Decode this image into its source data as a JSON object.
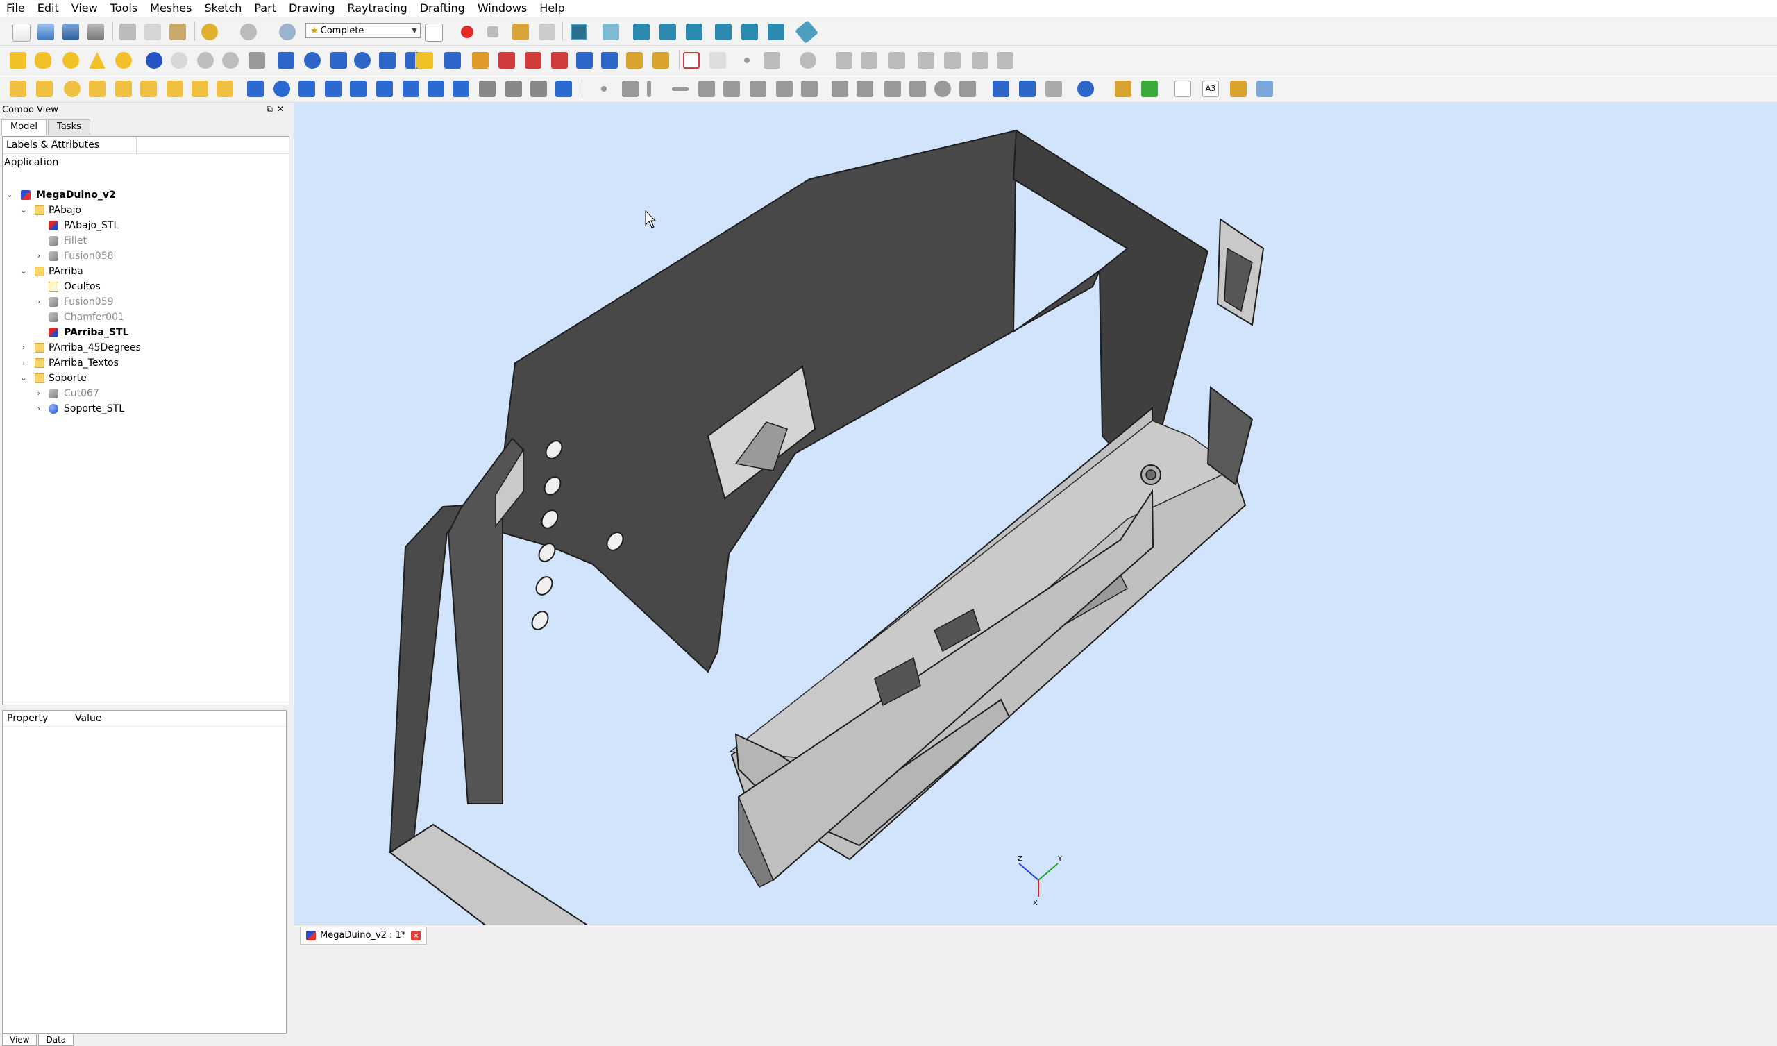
{
  "menu": [
    "File",
    "Edit",
    "View",
    "Tools",
    "Meshes",
    "Sketch",
    "Part",
    "Drawing",
    "Raytracing",
    "Drafting",
    "Windows",
    "Help"
  ],
  "toolbar": {
    "workbench": "Complete",
    "a3_label": "A3"
  },
  "combo_view": {
    "title": "Combo View",
    "tabs": [
      "Model",
      "Tasks"
    ],
    "header": "Labels & Attributes",
    "application": "Application"
  },
  "tree": [
    {
      "label": "MegaDuino_v2",
      "icon": "document-icon",
      "indent": 0,
      "twisty": "v",
      "style": "bold"
    },
    {
      "label": "PAbajo",
      "icon": "folder-icon",
      "indent": 1,
      "twisty": "v",
      "style": ""
    },
    {
      "label": "PAbajo_STL",
      "icon": "solid-icon",
      "indent": 2,
      "twisty": "",
      "style": ""
    },
    {
      "label": "Fillet",
      "icon": "grey-solid-icon",
      "indent": 2,
      "twisty": "",
      "style": "grey"
    },
    {
      "label": "Fusion058",
      "icon": "grey-solid-icon",
      "indent": 2,
      "twisty": ">",
      "style": "grey"
    },
    {
      "label": "PArriba",
      "icon": "folder-icon",
      "indent": 1,
      "twisty": "v",
      "style": ""
    },
    {
      "label": "Ocultos",
      "icon": "folder-white-icon",
      "indent": 2,
      "twisty": "",
      "style": ""
    },
    {
      "label": "Fusion059",
      "icon": "grey-solid-icon",
      "indent": 2,
      "twisty": ">",
      "style": "grey"
    },
    {
      "label": "Chamfer001",
      "icon": "grey-solid-icon",
      "indent": 2,
      "twisty": "",
      "style": "grey"
    },
    {
      "label": "PArriba_STL",
      "icon": "solid-icon",
      "indent": 2,
      "twisty": "",
      "style": "bold"
    },
    {
      "label": "PArriba_45Degrees",
      "icon": "folder-icon",
      "indent": 1,
      "twisty": ">",
      "style": ""
    },
    {
      "label": "PArriba_Textos",
      "icon": "folder-icon",
      "indent": 1,
      "twisty": ">",
      "style": ""
    },
    {
      "label": "Soporte",
      "icon": "folder-icon",
      "indent": 1,
      "twisty": "v",
      "style": ""
    },
    {
      "label": "Cut067",
      "icon": "grey-solid-icon",
      "indent": 2,
      "twisty": ">",
      "style": "grey"
    },
    {
      "label": "Soporte_STL",
      "icon": "sphere-icon",
      "indent": 2,
      "twisty": ">",
      "style": ""
    }
  ],
  "properties": {
    "col_property": "Property",
    "col_value": "Value"
  },
  "bottom_tabs": [
    "View",
    "Data"
  ],
  "document_tab": {
    "label": "MegaDuino_v2 : 1*",
    "close": "×"
  },
  "axis": {
    "x": "X",
    "y": "Y",
    "z": "Z"
  },
  "colors": {
    "viewport_bg": "#d2e4fb",
    "model_dark": "#484848",
    "model_light": "#c6c6c6"
  }
}
